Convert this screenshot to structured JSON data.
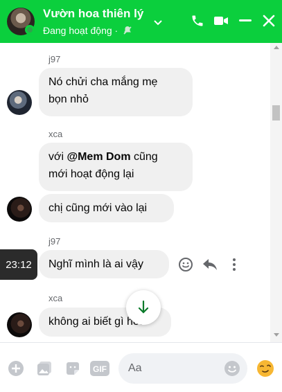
{
  "header": {
    "title": "Vườn hoa thiên lý",
    "status": "Đang hoạt động ·",
    "bg_color": "#0bcf3d"
  },
  "messages": [
    {
      "sender": "j97",
      "text": "Nó chửi cha mắng mẹ",
      "text2": "bọn nhỏ"
    },
    {
      "sender": "xca",
      "text_pre": "với ",
      "mention": "@Mem Dom",
      "text_post": " cũng",
      "text2": "mới hoạt động lại"
    },
    {
      "text": "chị cũng mới vào lại"
    },
    {
      "sender": "j97",
      "text": "Nghĩ mình là ai vậy"
    },
    {
      "sender": "xca",
      "text": "không ai biết gì hết"
    }
  ],
  "hover": {
    "timestamp": "23:12"
  },
  "composer": {
    "placeholder": "Aa",
    "value": ""
  },
  "icons": {
    "header": [
      "chevron-down-icon",
      "phone-icon",
      "video-icon",
      "minimize-icon",
      "close-icon"
    ],
    "actions": [
      "react-icon",
      "reply-icon",
      "more-icon"
    ],
    "composer": [
      "plus-icon",
      "gallery-icon",
      "sticker-icon",
      "gif-icon",
      "emoji-icon",
      "quick-reaction-icon"
    ]
  }
}
